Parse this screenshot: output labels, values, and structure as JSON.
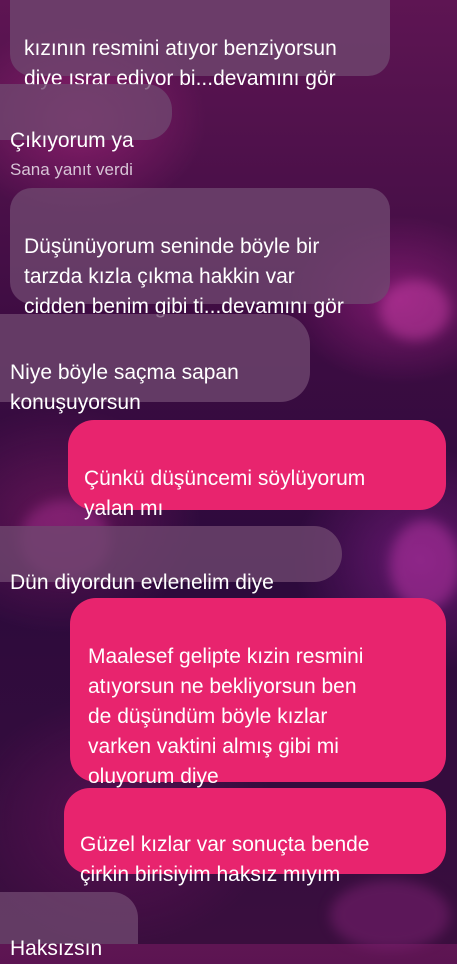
{
  "theme": {
    "incoming_bubble_color": "#6f4870",
    "outgoing_bubble_color": "#e8246e",
    "text_color": "#ffffff"
  },
  "messages": [
    {
      "direction": "incoming",
      "text": "kızının resmini atıyor benziyorsun\ndiye ısrar ediyor bi...devamını gör"
    },
    {
      "direction": "incoming",
      "text": "Çıkıyorum ya"
    },
    {
      "direction": "label",
      "text": "Sana yanıt verdi"
    },
    {
      "direction": "incoming",
      "text": "Düşünüyorum seninde böyle bir\ntarzda kızla çıkma hakkin var\ncidden benim gibi ti...devamını gör"
    },
    {
      "direction": "incoming",
      "text": "Niye böyle saçma sapan\nkonuşuyorsun"
    },
    {
      "direction": "outgoing",
      "text": "Çünkü düşüncemi söylüyorum\nyalan mı"
    },
    {
      "direction": "incoming",
      "text": "Dün diyordun evlenelim diye"
    },
    {
      "direction": "outgoing",
      "text": "Maalesef gelipte kızin resmini\natıyorsun ne bekliyorsun ben\nde düşündüm böyle kızlar\nvarken vaktini almış gibi mi\noluyorum diye"
    },
    {
      "direction": "outgoing",
      "text": "Güzel kızlar var sonuçta bende\nçirkin birisiyim haksız mıyım"
    },
    {
      "direction": "incoming",
      "text": "Haksızsın"
    }
  ]
}
